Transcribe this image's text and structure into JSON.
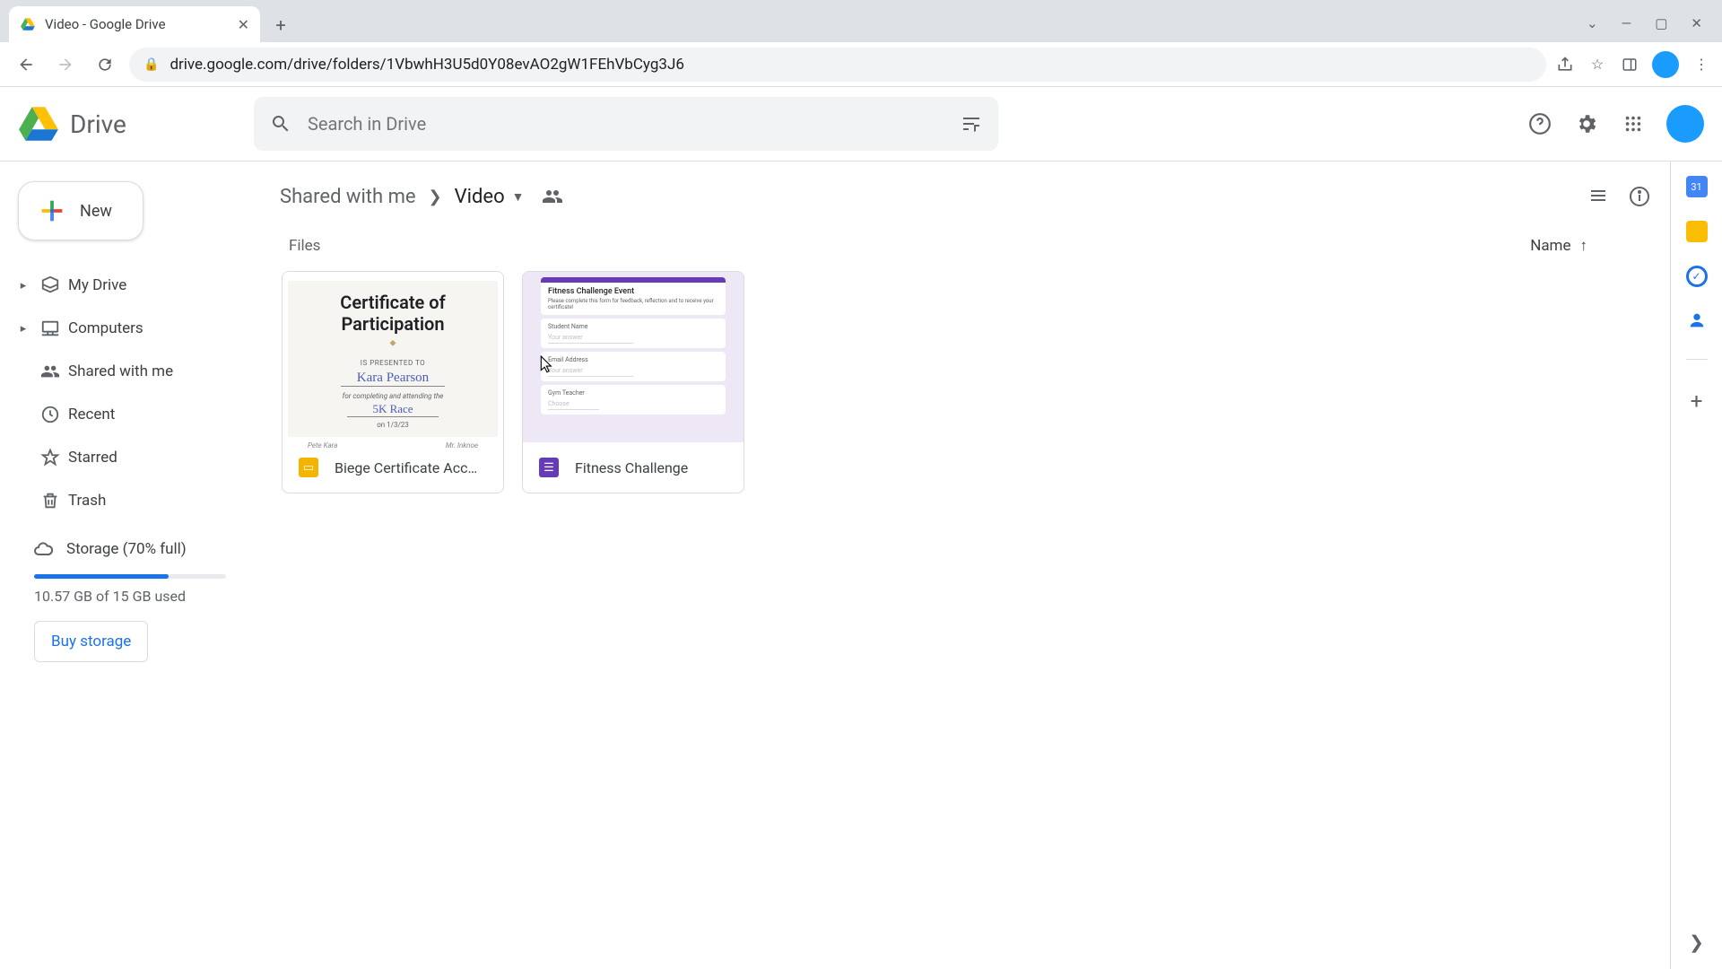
{
  "browser": {
    "tab_title": "Video - Google Drive",
    "url": "drive.google.com/drive/folders/1VbwhH3U5d0Y08evAO2gW1FEhVbCyg3J6"
  },
  "app": {
    "name": "Drive",
    "search_placeholder": "Search in Drive"
  },
  "sidebar": {
    "new_label": "New",
    "items": [
      {
        "label": "My Drive",
        "expandable": true
      },
      {
        "label": "Computers",
        "expandable": true
      },
      {
        "label": "Shared with me",
        "expandable": false
      },
      {
        "label": "Recent",
        "expandable": false
      },
      {
        "label": "Starred",
        "expandable": false
      },
      {
        "label": "Trash",
        "expandable": false
      }
    ],
    "storage": {
      "label": "Storage (70% full)",
      "percent": 70,
      "used_text": "10.57 GB of 15 GB used",
      "buy_label": "Buy storage"
    }
  },
  "breadcrumb": {
    "root": "Shared with me",
    "current": "Video"
  },
  "files_section": {
    "label": "Files",
    "sort_column": "Name"
  },
  "files": [
    {
      "name": "Biege Certificate Acc…",
      "type": "slides"
    },
    {
      "name": "Fitness Challenge",
      "type": "forms"
    }
  ],
  "cert_preview": {
    "title": "Certificate of Participation",
    "presented": "IS PRESENTED TO",
    "name": "Kara Pearson",
    "for": "for completing and attending the",
    "event": "5K Race",
    "date": "on 1/3/23",
    "sig_left": "Pete Kara",
    "sig_right": "Mr. Inknoe"
  },
  "form_preview": {
    "title": "Fitness Challenge Event",
    "subtitle": "Please complete this form for feedback, reflection and to receive your certificate!",
    "f1": "Student Name",
    "f1a": "Your answer",
    "f2": "Email Address",
    "f2a": "Your answer",
    "f3": "Gym Teacher",
    "f3a": "Choose"
  },
  "colors": {
    "accent": "#1a73e8",
    "avatar": "#1a9cff",
    "slides": "#f4b400",
    "forms": "#673ab7"
  }
}
